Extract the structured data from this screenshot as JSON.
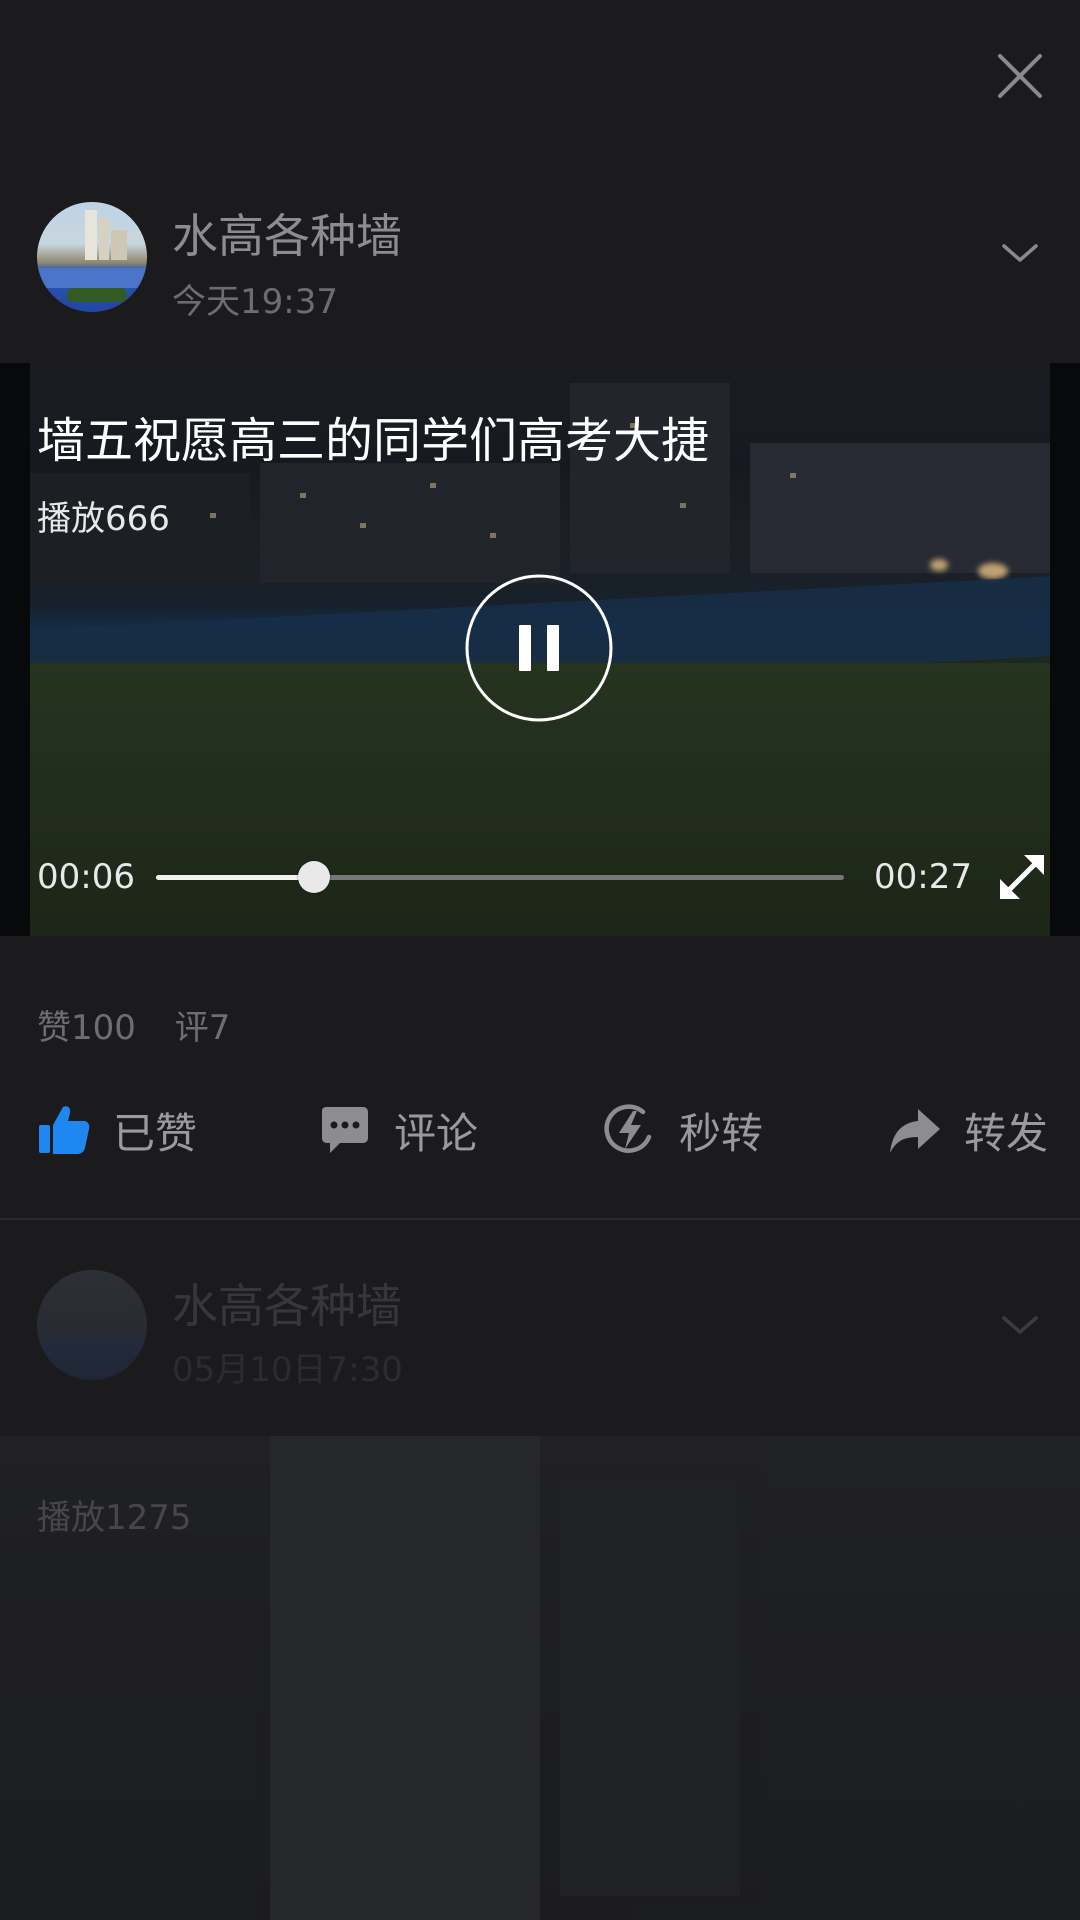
{
  "icons": {
    "close": "close-icon",
    "chevron": "chevron-down-icon",
    "pause": "pause-icon",
    "fullscreen": "fullscreen-icon",
    "like": "thumbs-up-icon",
    "comment": "comment-icon",
    "quick_repost": "lightning-icon",
    "forward": "share-arrow-icon"
  },
  "colors": {
    "background": "#1b1b1e",
    "liked_accent": "#1e88f0",
    "text_primary": "#ffffff",
    "text_muted": "#8d8d90"
  },
  "post": {
    "author": "水高各种墙",
    "time": "今天19:37",
    "video": {
      "title": "墙五祝愿高三的同学们高考大捷",
      "play_count": "播放666",
      "current_time": "00:06",
      "total_time": "00:27",
      "progress": 0.23,
      "state": "playing"
    },
    "stats": {
      "likes": "赞100",
      "comments": "评7"
    },
    "actions": {
      "like_label": "已赞",
      "like_state": "liked",
      "comment_label": "评论",
      "quick_repost_label": "秒转",
      "forward_label": "转发"
    }
  },
  "next_post": {
    "author": "水高各种墙",
    "time": "05月10日7:30",
    "play_count": "播放1275"
  }
}
